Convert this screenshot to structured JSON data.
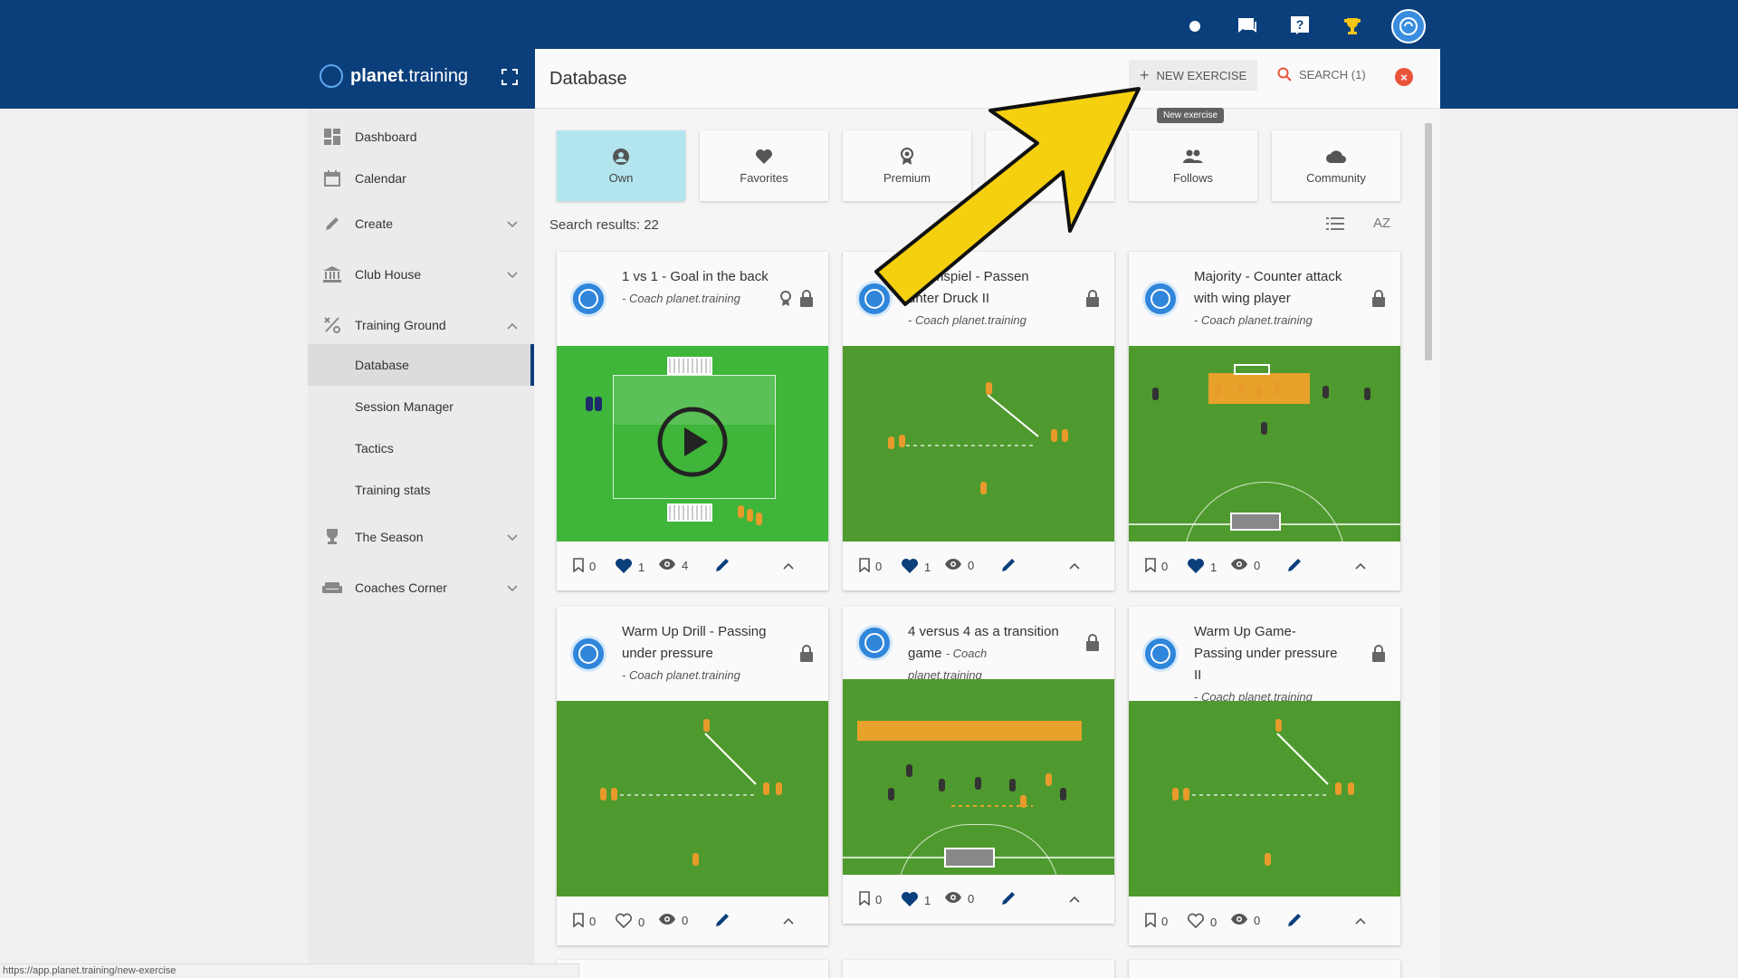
{
  "brand": {
    "name_bold": "planet",
    "name_rest": ".training"
  },
  "topbar": {
    "icons": [
      "status-dot-icon",
      "chat-icon",
      "help-icon",
      "trophy-icon",
      "user-avatar"
    ]
  },
  "sidebar": {
    "items": [
      {
        "label": "Dashboard",
        "icon": "dashboard-icon"
      },
      {
        "label": "Calendar",
        "icon": "calendar-icon"
      },
      {
        "label": "Create",
        "icon": "pencil-icon",
        "expandable": true
      },
      {
        "label": "Club House",
        "icon": "clubhouse-icon",
        "expandable": true
      },
      {
        "label": "Training Ground",
        "icon": "tactics-icon",
        "expandable": true,
        "expanded": true
      },
      {
        "label": "The Season",
        "icon": "trophy-icon",
        "expandable": true
      },
      {
        "label": "Coaches Corner",
        "icon": "sofa-icon",
        "expandable": true
      }
    ],
    "sub_items": [
      {
        "label": "Database",
        "active": true
      },
      {
        "label": "Session Manager"
      },
      {
        "label": "Tactics"
      },
      {
        "label": "Training stats"
      }
    ]
  },
  "header": {
    "title": "Database",
    "new_exercise": "NEW EXERCISE",
    "search": "SEARCH (1)",
    "tooltip": "New exercise"
  },
  "filters": [
    {
      "label": "Own",
      "icon": "person-icon",
      "active": true
    },
    {
      "label": "Favorites",
      "icon": "heart-icon"
    },
    {
      "label": "Premium",
      "icon": "award-icon"
    },
    {
      "label": "",
      "icon": ""
    },
    {
      "label": "Follows",
      "icon": "people-icon"
    },
    {
      "label": "Community",
      "icon": "cloud-icon"
    }
  ],
  "results_label": "Search results: 22",
  "sort_label": "AZ",
  "cards": [
    {
      "title": "1 vs 1 - Goal in the back",
      "author": "- Coach planet.training",
      "premium": true,
      "bookmarks": "0",
      "likes": "1",
      "views": "4",
      "liked": true,
      "has_video": true
    },
    {
      "title": "Warmspiel - Passen unter Druck II",
      "author": "- Coach planet.training",
      "premium": false,
      "bookmarks": "0",
      "likes": "1",
      "views": "0",
      "liked": true
    },
    {
      "title": "Majority - Counter attack with wing player",
      "author": "- Coach planet.training",
      "premium": false,
      "bookmarks": "0",
      "likes": "1",
      "views": "0",
      "liked": true
    },
    {
      "title": "Warm Up Drill - Passing under pressure",
      "author": "- Coach planet.training",
      "premium": false,
      "bookmarks": "0",
      "likes": "0",
      "views": "0",
      "liked": false
    },
    {
      "title": "4 versus 4 as a transition game",
      "author": "- Coach planet.training",
      "premium": false,
      "bookmarks": "0",
      "likes": "1",
      "views": "0",
      "liked": true
    },
    {
      "title": "Warm Up Game- Passing under pressure II",
      "author": "- Coach planet.training",
      "premium": false,
      "bookmarks": "0",
      "likes": "0",
      "views": "0",
      "liked": false
    }
  ],
  "status_url": "https://app.planet.training/new-exercise",
  "colors": {
    "topbar": "#0b3f7b",
    "accent": "#0b3f7b",
    "active_tab": "#b3e5ef",
    "arrow": "#f5d00f",
    "close": "#e8553c",
    "pitch": "#4f9a2e"
  }
}
